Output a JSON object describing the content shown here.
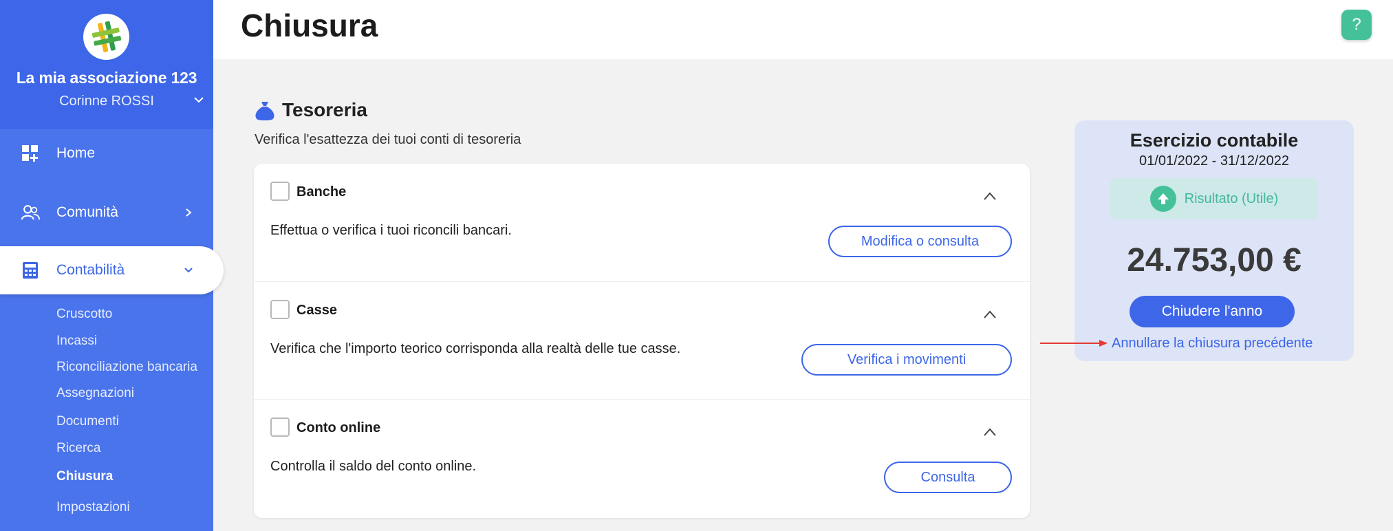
{
  "sidebar": {
    "org_name": "La mia associazione 123",
    "user_name": "Corinne ROSSI",
    "nav": [
      {
        "label": "Home",
        "icon": "dashboard-icon"
      },
      {
        "label": "Comunità",
        "icon": "users-icon"
      },
      {
        "label": "Contabilità",
        "icon": "calculator-icon"
      }
    ],
    "sub_items": [
      "Cruscotto",
      "Incassi",
      "Riconciliazione bancaria",
      "Assegnazioni",
      "Documenti",
      "Ricerca",
      "Chiusura",
      "Impostazioni"
    ],
    "active_sub": "Chiusura"
  },
  "header": {
    "title": "Chiusura",
    "help_label": "?"
  },
  "section": {
    "title": "Tesoreria",
    "icon": "money-bag-icon",
    "subtitle": "Verifica l'esattezza dei tuoi conti di tesoreria"
  },
  "rows": [
    {
      "title": "Banche",
      "desc": "Effettua o verifica i tuoi riconcili bancari.",
      "button": "Modifica o consulta"
    },
    {
      "title": "Casse",
      "desc": "Verifica che l'importo teorico corrisponda alla realtà delle tue casse.",
      "button": "Verifica i movimenti"
    },
    {
      "title": "Conto online",
      "desc": "Controlla il saldo del conto online.",
      "button": "Consulta"
    }
  ],
  "panel": {
    "title": "Esercizio contabile",
    "dates": "01/01/2022 - 31/12/2022",
    "result_label": "Risultato (Utile)",
    "amount": "24.753,00 €",
    "close_button": "Chiudere l'anno",
    "cancel_link": "Annullare la chiusura precédente"
  },
  "colors": {
    "primary": "#3d66e8",
    "sidebar": "#4a74ec",
    "accent_green": "#45c19a",
    "annotation_arrow": "#e53935"
  }
}
